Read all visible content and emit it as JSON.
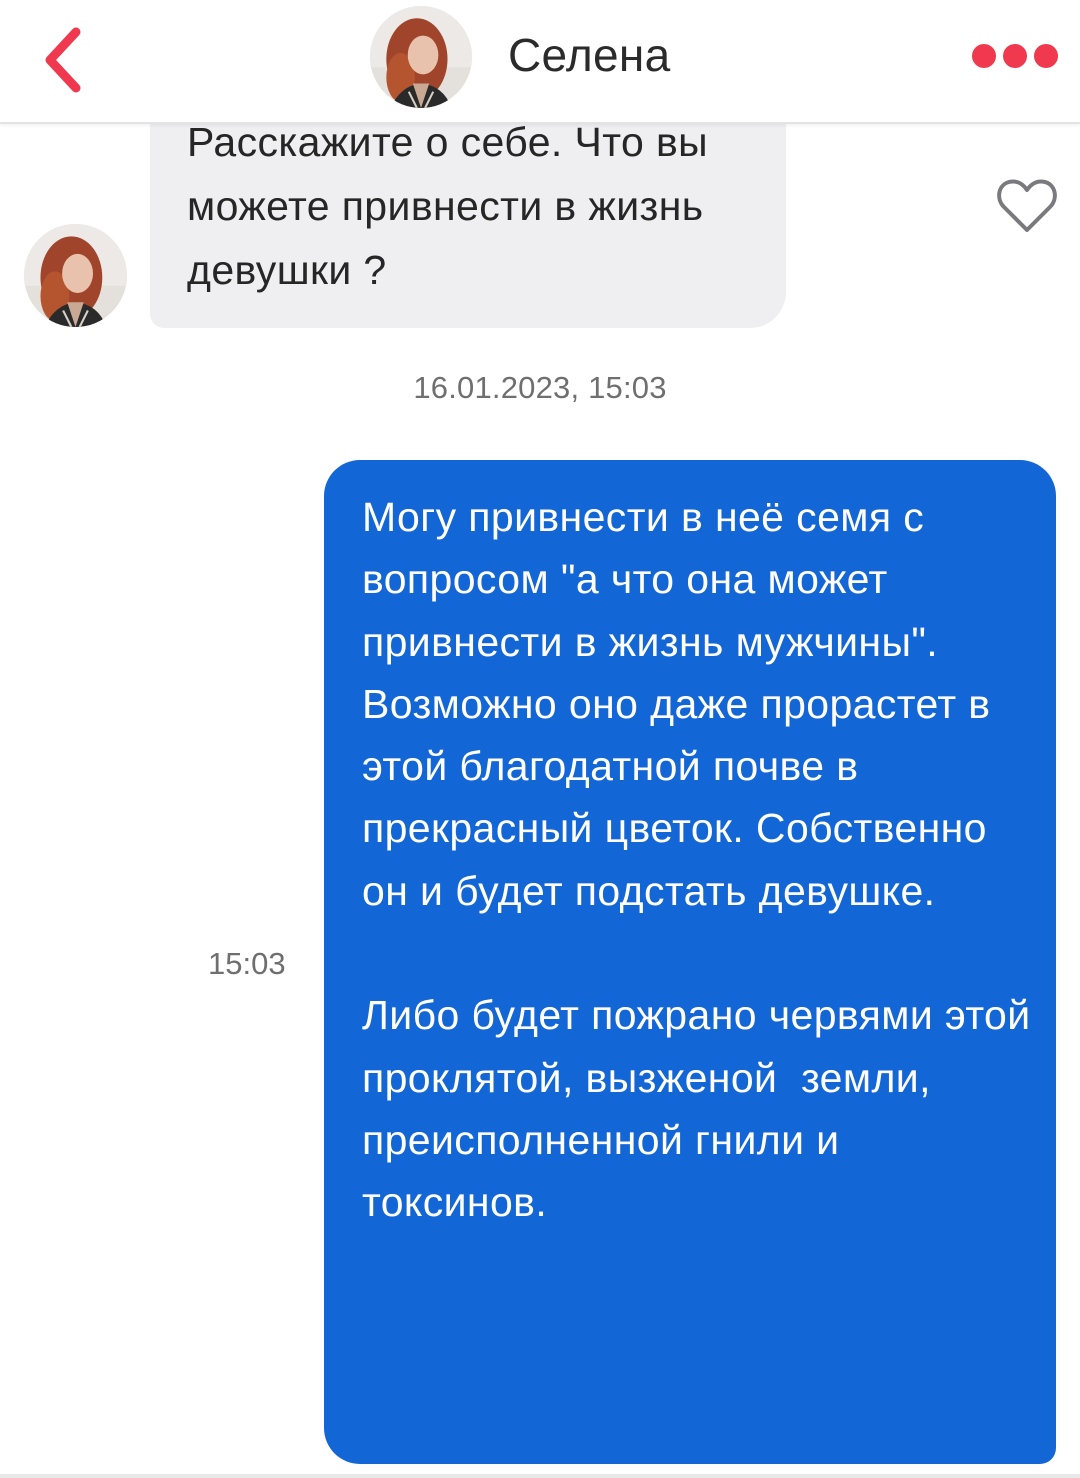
{
  "header": {
    "contact_name": "Селена",
    "back_icon": "chevron-left-icon",
    "menu_icon": "more-dots-icon",
    "accent_color": "#f0394e"
  },
  "messages": {
    "incoming": {
      "text": "Расскажите о себе. Что вы можете привнести в жизнь девушки ?",
      "like_icon": "heart-outline-icon"
    },
    "date_separator": "16.01.2023, 15:03",
    "outgoing": {
      "time": "15:03",
      "text": "Могу привнести в неё семя с вопросом \"а что она может привнести в жизнь мужчины\". Возможно оно даже прорастет в этой благодатной почве в прекрасный цветок. Собственно он и будет подстать девушке.\n\nЛибо будет пожрано червями этой проклятой, вызженой  земли, преисполненной гнили и токсинов.",
      "bubble_color": "#1366d6"
    }
  }
}
